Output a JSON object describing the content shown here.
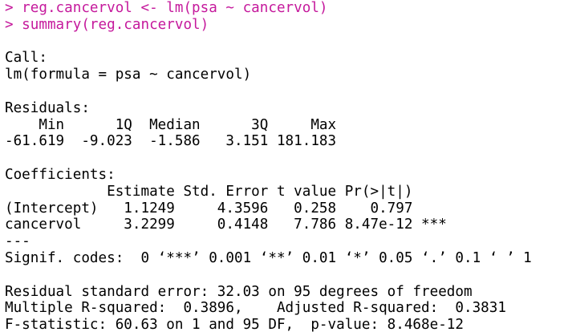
{
  "colors": {
    "background": "#ffffff",
    "command_text": "#c5199c",
    "output_text": "#000000"
  },
  "commands": [
    "> reg.cancervol <- lm(psa ~ cancervol)",
    "> summary(reg.cancervol)"
  ],
  "call": {
    "header": "Call:",
    "formula": "lm(formula = psa ~ cancervol)"
  },
  "residuals": {
    "header": "Residuals:",
    "labels_line": "    Min      1Q  Median      3Q     Max ",
    "values_line": "-61.619  -9.023  -1.586   3.151 181.183 "
  },
  "coefficients": {
    "header": "Coefficients:",
    "column_header_line": "            Estimate Std. Error t value Pr(>|t|)    ",
    "rows": [
      "(Intercept)   1.1249     4.3596   0.258    0.797    ",
      "cancervol     3.2299     0.4148   7.786 8.47e-12 ***"
    ],
    "separator": "---",
    "signif_codes": "Signif. codes:  0 ‘***’ 0.001 ‘**’ 0.01 ‘*’ 0.05 ‘.’ 0.1 ‘ ’ 1"
  },
  "fit_stats": {
    "residual_se": "Residual standard error: 32.03 on 95 degrees of freedom",
    "r_squared": "Multiple R-squared:  0.3896,\tAdjusted R-squared:  0.3831 ",
    "f_statistic": "F-statistic: 60.63 on 1 and 95 DF,  p-value: 8.468e-12"
  }
}
